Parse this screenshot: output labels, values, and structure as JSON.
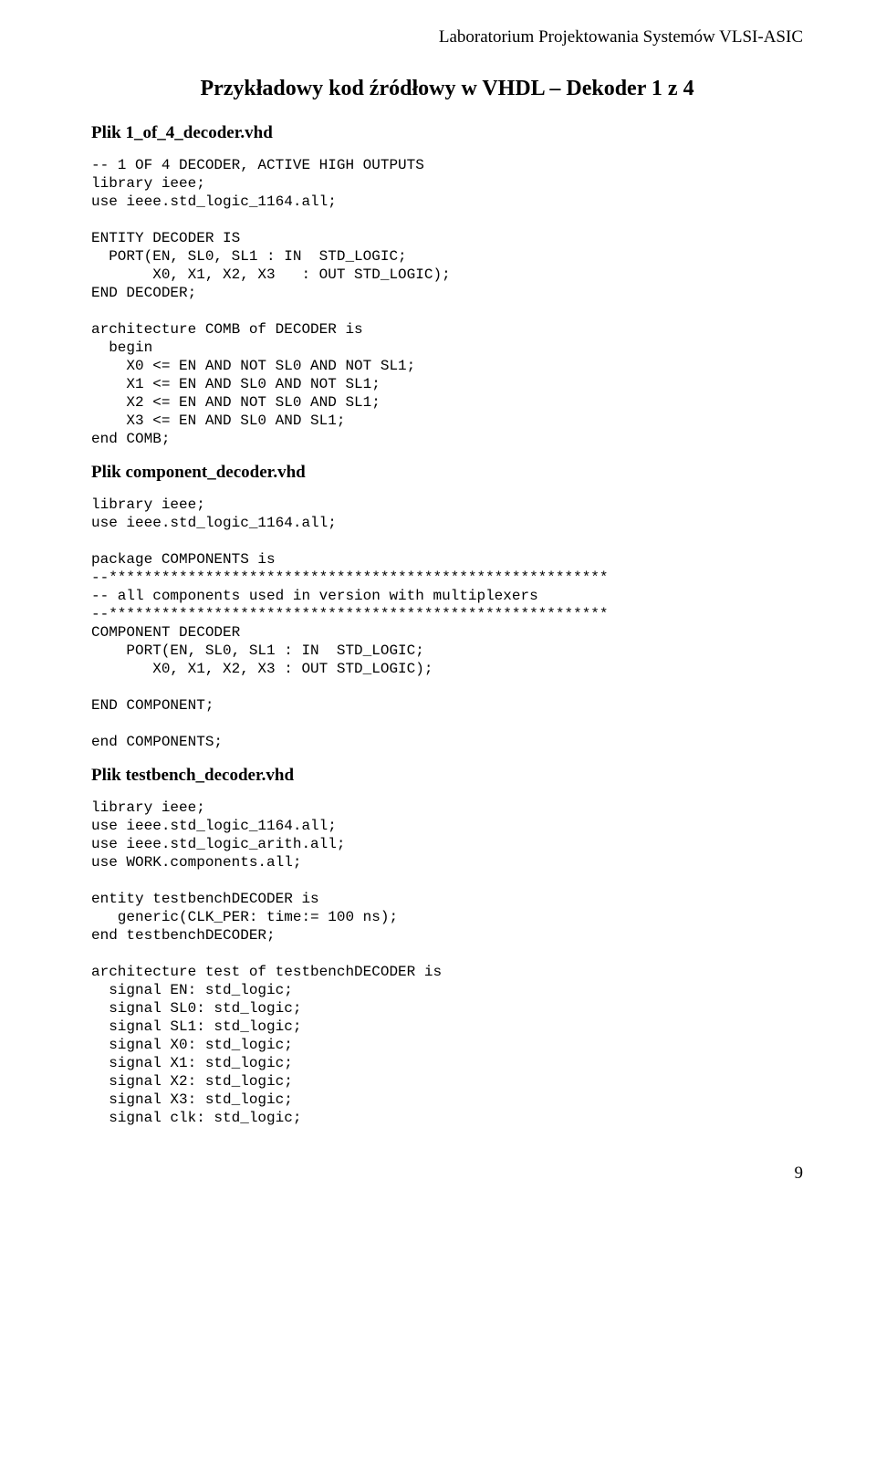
{
  "header": {
    "lab": "Laboratorium Projektowania Systemów VLSI-ASIC"
  },
  "title": "Przykładowy kod źródłowy w VHDL – Dekoder 1 z 4",
  "files": {
    "decoder": {
      "label": "Plik  1_of_4_decoder.vhd",
      "code": "-- 1 OF 4 DECODER, ACTIVE HIGH OUTPUTS\nlibrary ieee;\nuse ieee.std_logic_1164.all;\n\nENTITY DECODER IS\n  PORT(EN, SL0, SL1 : IN  STD_LOGIC;\n       X0, X1, X2, X3   : OUT STD_LOGIC);\nEND DECODER;\n\narchitecture COMB of DECODER is\n  begin\n    X0 <= EN AND NOT SL0 AND NOT SL1;\n    X1 <= EN AND SL0 AND NOT SL1;\n    X2 <= EN AND NOT SL0 AND SL1;\n    X3 <= EN AND SL0 AND SL1;\nend COMB;"
    },
    "component": {
      "label": "Plik  component_decoder.vhd",
      "code": "library ieee;\nuse ieee.std_logic_1164.all;\n\npackage COMPONENTS is\n--*********************************************************\n-- all components used in version with multiplexers\n--*********************************************************\nCOMPONENT DECODER\n    PORT(EN, SL0, SL1 : IN  STD_LOGIC;\n       X0, X1, X2, X3 : OUT STD_LOGIC);\n\nEND COMPONENT;\n\nend COMPONENTS;"
    },
    "testbench": {
      "label": "Plik testbench_decoder.vhd",
      "code": "library ieee;\nuse ieee.std_logic_1164.all;\nuse ieee.std_logic_arith.all;\nuse WORK.components.all;\n\nentity testbenchDECODER is\n   generic(CLK_PER: time:= 100 ns);\nend testbenchDECODER;\n\narchitecture test of testbenchDECODER is\n  signal EN: std_logic;\n  signal SL0: std_logic;\n  signal SL1: std_logic;\n  signal X0: std_logic;\n  signal X1: std_logic;\n  signal X2: std_logic;\n  signal X3: std_logic;\n  signal clk: std_logic;"
    }
  },
  "pageNumber": "9"
}
